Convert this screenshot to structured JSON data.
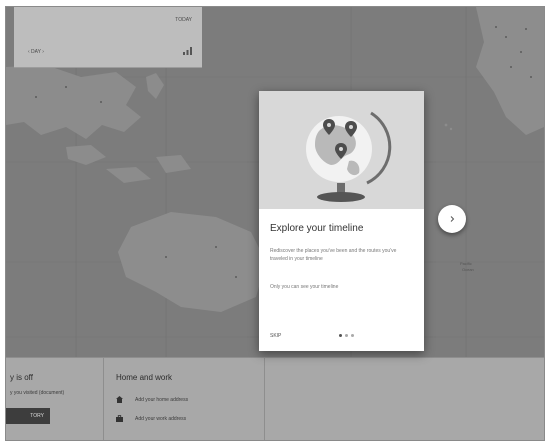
{
  "top_card": {
    "today_label": "TODAY",
    "date_selector": "‹   DAY   ›"
  },
  "onboarding": {
    "title": "Explore your timeline",
    "description": "Rediscover the places you've been and the routes you've traveled in your timeline",
    "privacy_note": "Only you can see your timeline",
    "skip_label": "SKIP",
    "pages_total": 3,
    "current_page": 1
  },
  "location_history": {
    "title_fragment": "y is off",
    "subtitle_fragment": "y you visited (document)",
    "button_fragment": "TORY"
  },
  "home_work": {
    "title": "Home and work",
    "home_label": "Add your home address",
    "work_label": "Add your work address"
  },
  "map_labels": {
    "pacific": "Pacific\nOcean"
  },
  "colors": {
    "overlay": "#282828",
    "dialog_bg": "#ffffff",
    "hero_bg": "#d8d8d8"
  }
}
